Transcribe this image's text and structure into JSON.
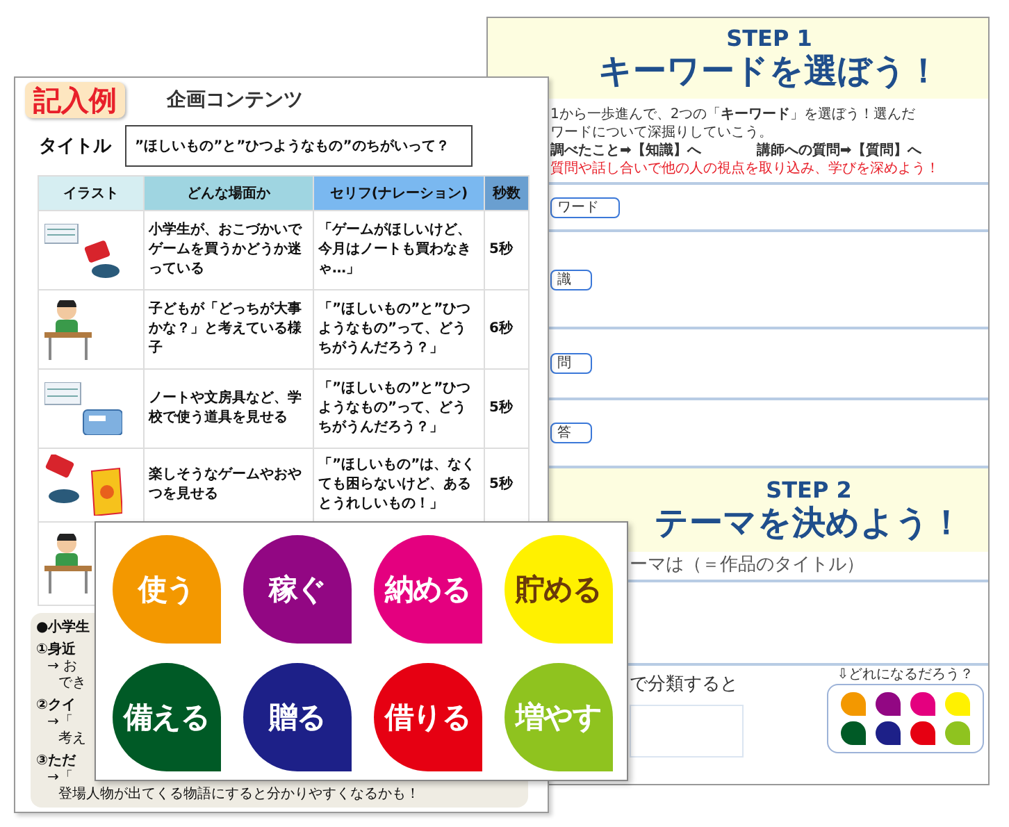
{
  "keyword_sheet": {
    "step1": {
      "step": "STEP 1",
      "heading": "キーワードを選ぼう！"
    },
    "intro": [
      "1から一歩進んで、2つの「**キーワード**」を選ぼう！選んだ",
      "ワードについて深掘りしていこう。"
    ],
    "routes": [
      "調べたこと➡【知識】へ",
      "講師への質問➡【質問】へ"
    ],
    "tip": "質問や話し合いで他の人の視点を取り込み、学びを深めよう！",
    "fields": [
      {
        "label": "ワード"
      },
      {
        "label": "識"
      },
      {
        "label": "問"
      },
      {
        "label": "答"
      }
    ],
    "step2": {
      "step": "STEP 2",
      "heading": "テーマを決めよう！"
    },
    "theme_label": "ーマは（＝作品のタイトル）",
    "classify_label": "で分類すると",
    "hint": "⇩どれになるだろう？",
    "mini_keywords": [
      {
        "color": "#f39800"
      },
      {
        "color": "#920783"
      },
      {
        "color": "#e4007f"
      },
      {
        "color": "#fff100"
      },
      {
        "color": "#005a26"
      },
      {
        "color": "#1d2088"
      },
      {
        "color": "#e60012"
      },
      {
        "color": "#8fc31f"
      }
    ]
  },
  "plan_sheet": {
    "badge": "記入例",
    "title": "企画コンテンツ",
    "title_label": "タイトル",
    "title_value": "”ほしいもの”と”ひつようなもの”のちがいって？",
    "table": {
      "columns": [
        "イラスト",
        "どんな場面か",
        "セリフ(ナレーション)",
        "秒数"
      ],
      "rows": [
        {
          "kind": "game",
          "scene": "小学生が、おこづかいでゲームを買うかどうか迷っている",
          "line": "「ゲームがほしいけど、今月はノートも買わなきゃ…」",
          "seconds": "5秒"
        },
        {
          "kind": "thinking",
          "scene": "子どもが「どっちが大事かな？」と考えている様子",
          "line": "「”ほしいもの”と”ひつようなもの”って、どうちがうんだろう？」",
          "seconds": "6秒"
        },
        {
          "kind": "stationery",
          "scene": "ノートや文房具など、学校で使う道具を見せる",
          "line": "「”ほしいもの”と”ひつようなもの”って、どうちがうんだろう？」",
          "seconds": "5秒"
        },
        {
          "kind": "snacks",
          "scene": "楽しそうなゲームやおやつを見せる",
          "line": "「”ほしいもの”は、なくても困らないけど、あるとうれしいもの！」",
          "seconds": "5秒"
        },
        {
          "kind": "thinking"
        }
      ]
    },
    "notes": [
      {
        "kind": "head",
        "text": "●小学生"
      },
      {
        "kind": "item",
        "text": "①身近"
      },
      {
        "kind": "sub",
        "text": "→ お"
      },
      {
        "kind": "cont",
        "text": "でき"
      },
      {
        "kind": "item",
        "text": "②クイ"
      },
      {
        "kind": "sub",
        "text": "→「"
      },
      {
        "kind": "cont",
        "text": "考え"
      },
      {
        "kind": "item",
        "text": "③ただ"
      },
      {
        "kind": "sub",
        "text": "→「"
      },
      {
        "kind": "cont",
        "text": "登場人物が出てくる物語にすると分かりやすくなるかも！"
      }
    ]
  },
  "tile_board": {
    "keywords": [
      {
        "label": "使う",
        "color": "#f39800"
      },
      {
        "label": "稼ぐ",
        "color": "#920783"
      },
      {
        "label": "納める",
        "color": "#e4007f"
      },
      {
        "label": "貯める",
        "color": "#fff100"
      },
      {
        "label": "備える",
        "color": "#005a26"
      },
      {
        "label": "贈る",
        "color": "#1d2088"
      },
      {
        "label": "借りる",
        "color": "#e60012"
      },
      {
        "label": "増やす",
        "color": "#8fc31f"
      }
    ]
  }
}
